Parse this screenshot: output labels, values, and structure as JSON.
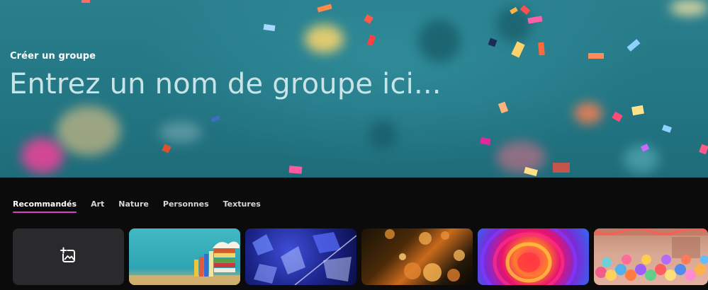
{
  "hero": {
    "subtitle": "Créer un groupe",
    "title": "Entrez un nom de groupe ici..."
  },
  "tabs": [
    {
      "label": "Recommandés",
      "active": true
    },
    {
      "label": "Art",
      "active": false
    },
    {
      "label": "Nature",
      "active": false
    },
    {
      "label": "Personnes",
      "active": false
    },
    {
      "label": "Textures",
      "active": false
    }
  ],
  "thumbnails": [
    {
      "name": "add-image",
      "icon": "add-image-icon"
    },
    {
      "name": "books-teal-wall"
    },
    {
      "name": "blue-crystals"
    },
    {
      "name": "golden-bubbles"
    },
    {
      "name": "rainbow-swirl"
    },
    {
      "name": "balloons-room"
    }
  ],
  "colors": {
    "accent": "#d940c4",
    "hero_bg": "#237684",
    "page_bg": "#0b0b0c"
  }
}
